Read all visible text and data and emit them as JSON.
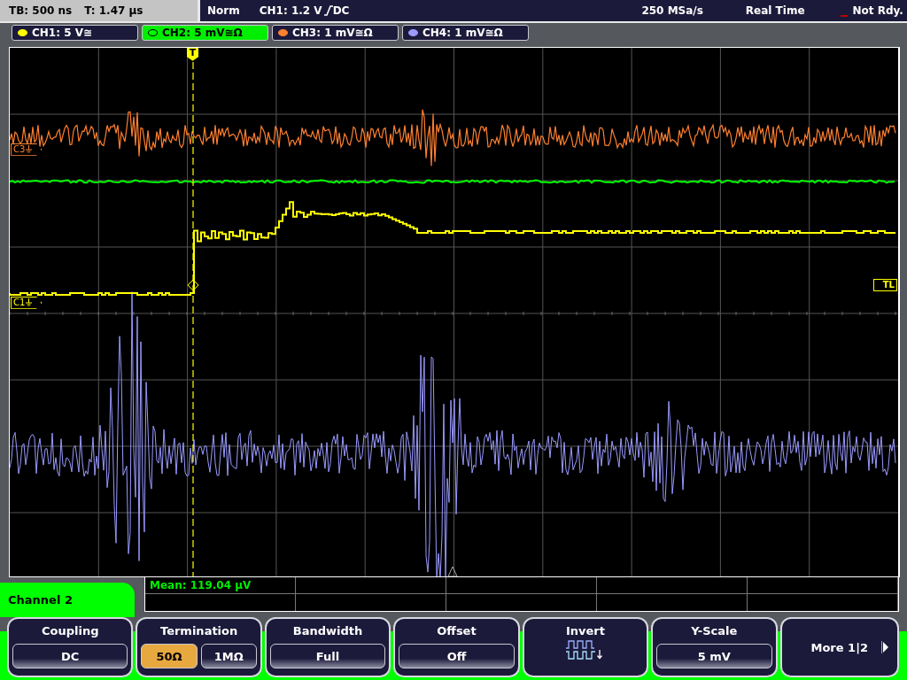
{
  "status_bar": {
    "timebase": "TB: 500 ns",
    "trigger_time": "T: 1.47 µs",
    "mode": "Norm",
    "trigger_source": "CH1: 1.2 V",
    "trigger_coupling": "DC",
    "sample_rate": "250 MSa/s",
    "acquisition": "Real Time",
    "state": "Not Rdy."
  },
  "channels": [
    {
      "label": "CH1: 5 V≅",
      "color": "#ffff00",
      "selected": false
    },
    {
      "label": "CH2: 5 mV≅Ω",
      "color": "#00ff00",
      "selected": true
    },
    {
      "label": "CH3: 1 mV≅Ω",
      "color": "#ff8030",
      "selected": false
    },
    {
      "label": "CH4: 1 mV≅Ω",
      "color": "#9a9aff",
      "selected": false
    }
  ],
  "screen": {
    "trigger_marker": "T",
    "trigger_level_marker": "TL",
    "markers": [
      {
        "label": "C3",
        "color": "#ff8030"
      },
      {
        "label": "C1",
        "color": "#ffff00"
      }
    ]
  },
  "measurement": {
    "text": "Mean: 119.04 µV"
  },
  "menu": {
    "title": "Channel 2",
    "keys": [
      {
        "kind": "value",
        "label": "Coupling",
        "value": "DC"
      },
      {
        "kind": "toggle",
        "label": "Termination",
        "options": [
          {
            "label": "50Ω",
            "selected": true
          },
          {
            "label": "1MΩ",
            "selected": false
          }
        ]
      },
      {
        "kind": "value",
        "label": "Bandwidth",
        "value": "Full"
      },
      {
        "kind": "value",
        "label": "Offset",
        "value": "Off"
      },
      {
        "kind": "icon",
        "label": "Invert"
      },
      {
        "kind": "value",
        "label": "Y-Scale",
        "value": "5 mV"
      },
      {
        "kind": "more",
        "label": "More 1|2"
      }
    ]
  }
}
